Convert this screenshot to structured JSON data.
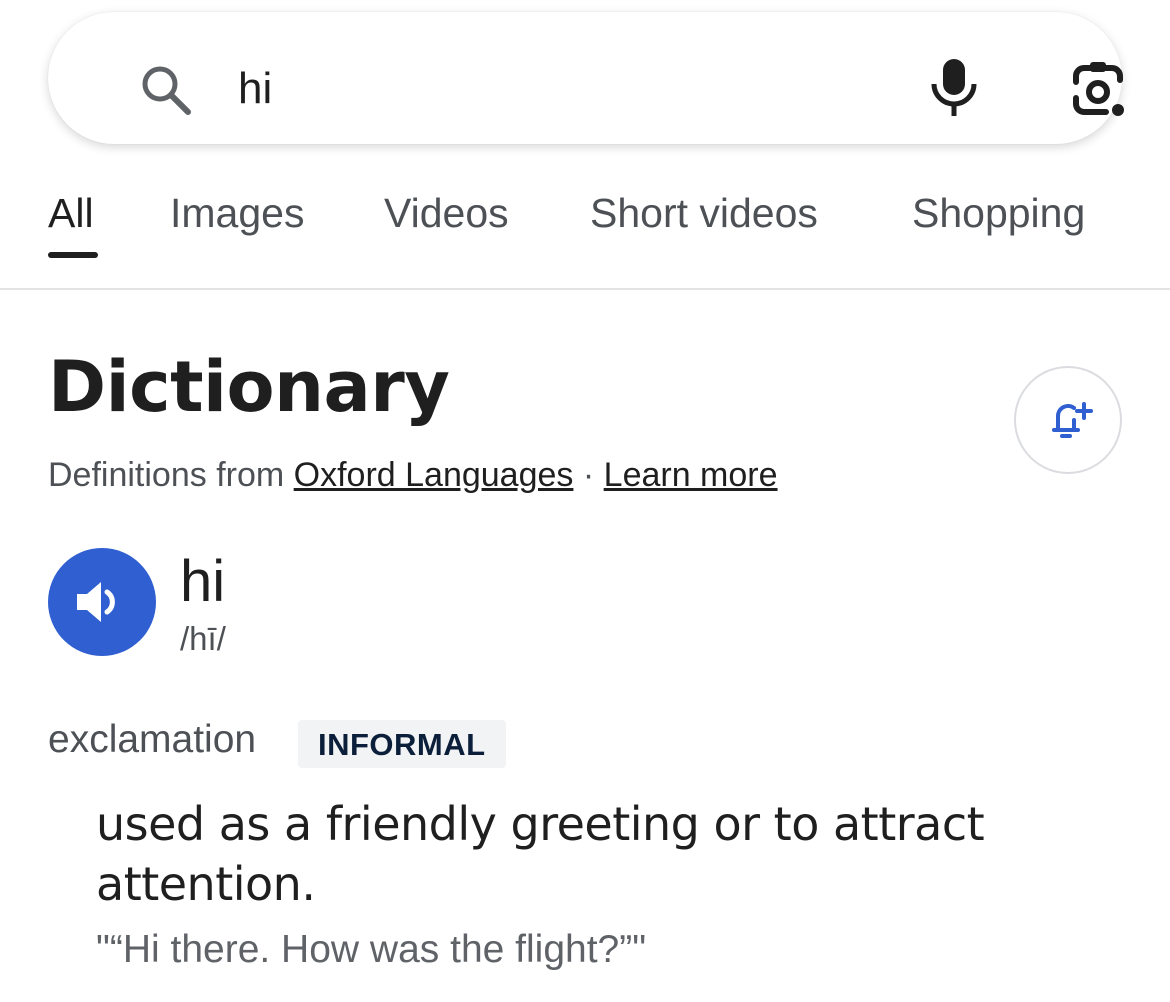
{
  "search": {
    "value": "hi",
    "search_icon": "search-icon",
    "mic_icon": "microphone-icon",
    "lens_icon": "camera-lens-icon"
  },
  "tabs": [
    {
      "label": "All",
      "active": true
    },
    {
      "label": "Images"
    },
    {
      "label": "Videos"
    },
    {
      "label": "Short videos"
    },
    {
      "label": "Shopping"
    }
  ],
  "dictionary": {
    "title": "Dictionary",
    "source_prefix": "Definitions from",
    "source_link": "Oxford Languages",
    "separator": "·",
    "learn_more": "Learn more",
    "alert_icon": "bell-plus-icon",
    "speaker_icon": "speaker-icon",
    "word": "hi",
    "phonetic": "/hī/",
    "part_of_speech": "exclamation",
    "label": "INFORMAL",
    "definition": "used as a friendly greeting or to attract attention.",
    "example": "\"“Hi there. How was the flight?”\""
  },
  "colors": {
    "accent_blue": "#2f5fd0",
    "text_primary": "#1f1f1f",
    "text_secondary": "#4d5156",
    "badge_bg": "#f1f3f4"
  }
}
